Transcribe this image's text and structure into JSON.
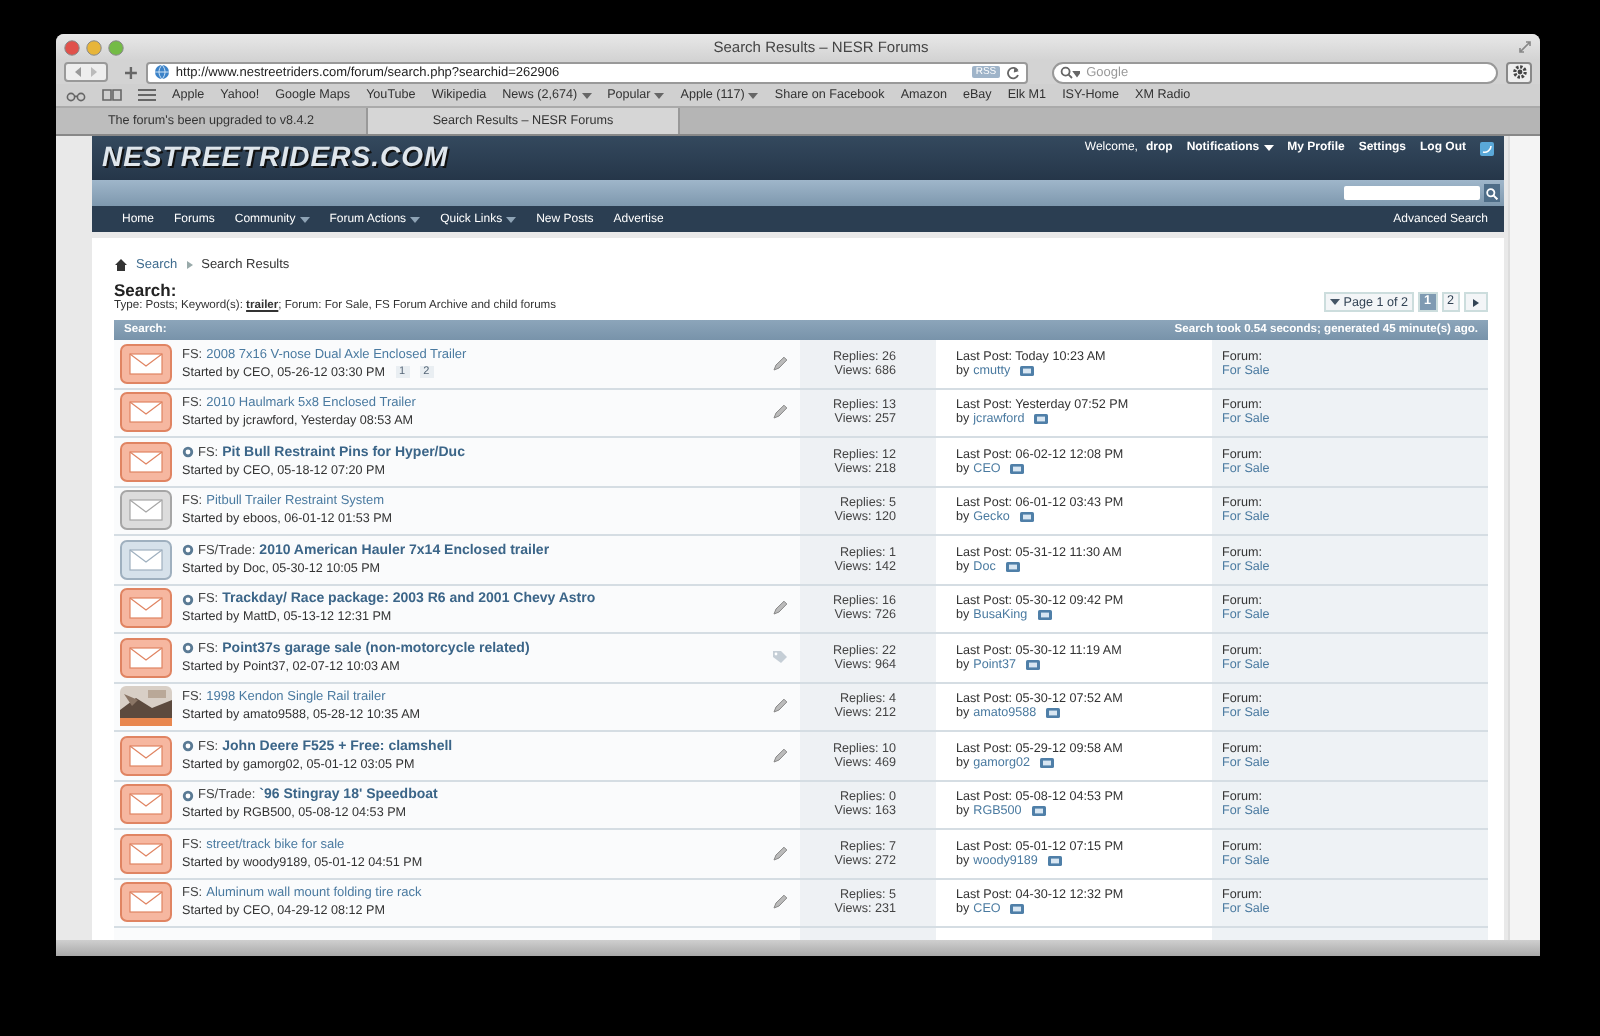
{
  "browser": {
    "title": "Search Results – NESR Forums",
    "url": "http://www.nestreetriders.com/forum/search.php?searchid=262906",
    "reader_badge": "RSS",
    "search_placeholder": "Google",
    "bookmarks": [
      {
        "label": "Apple",
        "menu": false
      },
      {
        "label": "Yahoo!",
        "menu": false
      },
      {
        "label": "Google Maps",
        "menu": false
      },
      {
        "label": "YouTube",
        "menu": false
      },
      {
        "label": "Wikipedia",
        "menu": false
      },
      {
        "label": "News (2,674)",
        "menu": true
      },
      {
        "label": "Popular",
        "menu": true
      },
      {
        "label": "Apple (117)",
        "menu": true
      },
      {
        "label": "Share on Facebook",
        "menu": false
      },
      {
        "label": "Amazon",
        "menu": false
      },
      {
        "label": "eBay",
        "menu": false
      },
      {
        "label": "Elk M1",
        "menu": false
      },
      {
        "label": "ISY-Home",
        "menu": false
      },
      {
        "label": "XM Radio",
        "menu": false
      }
    ],
    "tabs": [
      {
        "label": "The forum's been upgraded to v8.4.2",
        "selected": false
      },
      {
        "label": "Search Results – NESR Forums",
        "selected": true
      }
    ]
  },
  "site": {
    "logo": "NESTREETRIDERS.COM",
    "welcome": "Welcome, **drop**",
    "user_links": [
      {
        "label": "Notifications",
        "menu": true
      },
      {
        "label": "My Profile",
        "menu": false
      },
      {
        "label": "Settings",
        "menu": false
      },
      {
        "label": "Log Out",
        "menu": false
      }
    ],
    "nav": [
      {
        "label": "Home",
        "menu": false
      },
      {
        "label": "Forums",
        "menu": false
      },
      {
        "label": "Community",
        "menu": true
      },
      {
        "label": "Forum Actions",
        "menu": true
      },
      {
        "label": "Quick Links",
        "menu": true
      },
      {
        "label": "New Posts",
        "menu": false
      },
      {
        "label": "Advertise",
        "menu": false
      }
    ],
    "advanced_search": "Advanced Search"
  },
  "breadcrumb": [
    "Search",
    "Search Results"
  ],
  "search": {
    "heading": "Search:",
    "criteria": "Type: Posts; Keyword(s): **trailer**; Forum: For Sale, FS Forum Archive and child forums",
    "pager_label": "Page 1 of 2",
    "pages": [
      {
        "label": "1",
        "selected": true
      },
      {
        "label": "2",
        "selected": false
      }
    ],
    "bar_title": "Search:",
    "timing": "Search took 0.54 seconds; generated 45 minute(s) ago."
  },
  "threads": [
    {
      "kind": "orange",
      "unread": false,
      "prefix": "FS:",
      "title": "2008 7x16 V-nose Dual Axle Enclosed Trailer",
      "started": "Started by CEO, 05-26-12 03:30 PM",
      "pages": [
        "1",
        "2"
      ],
      "marker": {
        "kind": "pencil"
      },
      "replies": "Replies: 26",
      "views": "Views: 686",
      "last_post": "Last Post: Today 10:23 AM",
      "by": "by",
      "last_user": "cmutty",
      "forum_label": "Forum:",
      "forum": "For Sale"
    },
    {
      "kind": "orange",
      "unread": false,
      "prefix": "FS:",
      "title": "2010 Haulmark 5x8 Enclosed Trailer",
      "started": "Started by jcrawford, Yesterday 08:53 AM",
      "marker": {
        "kind": "pencil"
      },
      "replies": "Replies: 13",
      "views": "Views: 257",
      "last_post": "Last Post: Yesterday 07:52 PM",
      "by": "by",
      "last_user": "jcrawford",
      "forum_label": "Forum:",
      "forum": "For Sale"
    },
    {
      "kind": "orange",
      "unread": true,
      "prefix": "FS:",
      "title": "Pit Bull Restraint Pins for Hyper/Duc",
      "started": "Started by CEO, 05-18-12 07:20 PM",
      "replies": "Replies: 12",
      "views": "Views: 218",
      "last_post": "Last Post: 06-02-12 12:08 PM",
      "by": "by",
      "last_user": "CEO",
      "forum_label": "Forum:",
      "forum": "For Sale"
    },
    {
      "kind": "grey",
      "unread": false,
      "prefix": "FS:",
      "title": "Pitbull Trailer Restraint System",
      "started": "Started by eboos, 06-01-12 01:53 PM",
      "replies": "Replies: 5",
      "views": "Views: 120",
      "last_post": "Last Post: 06-01-12 03:43 PM",
      "by": "by",
      "last_user": "Gecko",
      "forum_label": "Forum:",
      "forum": "For Sale"
    },
    {
      "kind": "steel",
      "unread": true,
      "prefix": "FS/Trade:",
      "title": "2010 American Hauler 7x14 Enclosed trailer",
      "started": "Started by Doc, 05-30-12 10:05 PM",
      "replies": "Replies: 1",
      "views": "Views: 142",
      "last_post": "Last Post: 05-31-12 11:30 AM",
      "by": "by",
      "last_user": "Doc",
      "forum_label": "Forum:",
      "forum": "For Sale"
    },
    {
      "kind": "orange",
      "unread": true,
      "prefix": "FS:",
      "title": "Trackday/ Race package: 2003 R6 and 2001 Chevy Astro",
      "started": "Started by MattD, 05-13-12 12:31 PM",
      "marker": {
        "kind": "pencil"
      },
      "replies": "Replies: 16",
      "views": "Views: 726",
      "last_post": "Last Post: 05-30-12 09:42 PM",
      "by": "by",
      "last_user": "BusaKing",
      "forum_label": "Forum:",
      "forum": "For Sale"
    },
    {
      "kind": "orange",
      "unread": true,
      "prefix": "FS:",
      "title": "Point37s garage sale (non-motorcycle related)",
      "started": "Started by Point37, 02-07-12 10:03 AM",
      "marker": {
        "kind": "tag"
      },
      "replies": "Replies: 22",
      "views": "Views: 964",
      "last_post": "Last Post: 05-30-12 11:19 AM",
      "by": "by",
      "last_user": "Point37",
      "forum_label": "Forum:",
      "forum": "For Sale"
    },
    {
      "unread": false,
      "prefix": "FS:",
      "title": "1998 Kendon Single Rail trailer",
      "started": "Started by amato9588, 05-28-12 10:35 AM",
      "marker": {
        "kind": "pencil"
      },
      "replies": "Replies: 4",
      "views": "Views: 212",
      "last_post": "Last Post: 05-30-12 07:52 AM",
      "by": "by",
      "last_user": "amato9588",
      "forum_label": "Forum:",
      "forum": "For Sale"
    },
    {
      "kind": "orange",
      "unread": true,
      "prefix": "FS:",
      "title": "John Deere F525 + Free: clamshell",
      "started": "Started by gamorg02, 05-01-12 03:05 PM",
      "marker": {
        "kind": "pencil"
      },
      "replies": "Replies: 10",
      "views": "Views: 469",
      "last_post": "Last Post: 05-29-12 09:58 AM",
      "by": "by",
      "last_user": "gamorg02",
      "forum_label": "Forum:",
      "forum": "For Sale"
    },
    {
      "kind": "orange",
      "unread": true,
      "prefix": "FS/Trade:",
      "title": "`96 Stingray 18' Speedboat",
      "started": "Started by RGB500, 05-08-12 04:53 PM",
      "replies": "Replies: 0",
      "views": "Views: 163",
      "last_post": "Last Post: 05-08-12 04:53 PM",
      "by": "by",
      "last_user": "RGB500",
      "forum_label": "Forum:",
      "forum": "For Sale"
    },
    {
      "kind": "orange",
      "unread": false,
      "prefix": "FS:",
      "title": "street/track bike for sale",
      "started": "Started by woody9189, 05-01-12 04:51 PM",
      "marker": {
        "kind": "pencil"
      },
      "replies": "Replies: 7",
      "views": "Views: 272",
      "last_post": "Last Post: 05-01-12 07:15 PM",
      "by": "by",
      "last_user": "woody9189",
      "forum_label": "Forum:",
      "forum": "For Sale"
    },
    {
      "kind": "orange",
      "unread": false,
      "prefix": "FS:",
      "title": "Aluminum wall mount folding tire rack",
      "started": "Started by CEO, 04-29-12 08:12 PM",
      "marker": {
        "kind": "pencil"
      },
      "replies": "Replies: 5",
      "views": "Views: 231",
      "last_post": "Last Post: 04-30-12 12:32 PM",
      "by": "by",
      "last_user": "CEO",
      "forum_label": "Forum:",
      "forum": "For Sale"
    }
  ]
}
